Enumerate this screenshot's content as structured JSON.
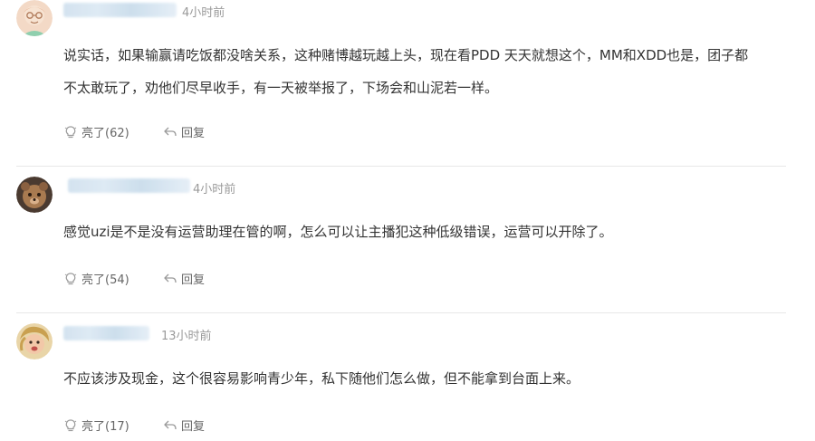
{
  "comments": [
    {
      "time": "4小时前",
      "text_lines": [
        "说实话，如果输赢请吃饭都没啥关系，这种赌博越玩越上头，现在看PDD 天天就想这个，MM和XDD也是，团子都",
        "不太敢玩了，劝他们尽早收手，有一天被举报了，下场会和山泥若一样。"
      ],
      "like_label": "亮了(62)",
      "reply_label": "回复"
    },
    {
      "time": "4小时前",
      "text_lines": [
        "感觉uzi是不是没有运营助理在管的啊，怎么可以让主播犯这种低级错误，运营可以开除了。"
      ],
      "like_label": "亮了(54)",
      "reply_label": "回复"
    },
    {
      "time": "13小时前",
      "text_lines": [
        "不应该涉及现金，这个很容易影响青少年，私下随他们怎么做，但不能拿到台面上来。"
      ],
      "like_label": "亮了(17)",
      "reply_label": "回复"
    }
  ],
  "icons": {
    "like": "lightbulb-icon",
    "reply": "reply-arrow-icon"
  },
  "colors": {
    "text": "#333333",
    "meta": "#9a9a9a",
    "action": "#666666",
    "divider": "#e8e8e8"
  }
}
